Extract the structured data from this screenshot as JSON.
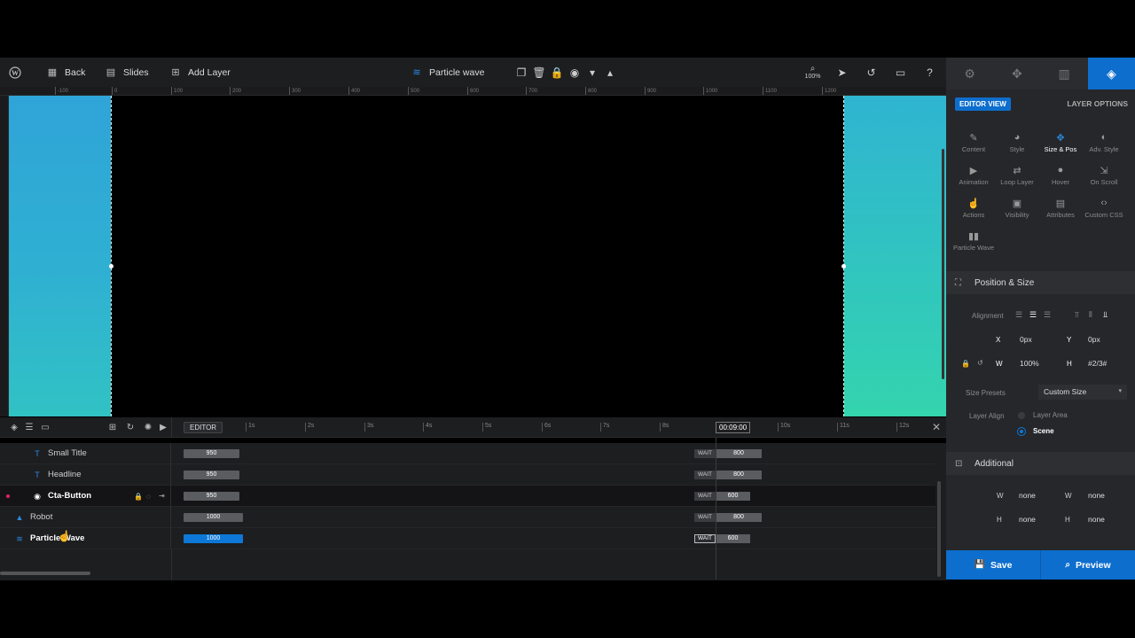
{
  "toolbar": {
    "back_label": "Back",
    "slides_label": "Slides",
    "add_layer_label": "Add Layer",
    "layer_name": "Particle wave",
    "zoom_label": "100%"
  },
  "ruler": {
    "ticks": [
      "-100",
      "0",
      "100",
      "200",
      "300",
      "400",
      "500",
      "600",
      "700",
      "800",
      "900",
      "1000",
      "1100",
      "1200"
    ]
  },
  "timeline": {
    "editor_label": "EDITOR",
    "current_time": "00:09:00",
    "time_labels": [
      "1s",
      "2s",
      "3s",
      "4s",
      "5s",
      "6s",
      "7s",
      "8s",
      "10s",
      "11s",
      "12s"
    ]
  },
  "layers": [
    {
      "name": "Small Title",
      "icon": "text-icon",
      "start": "950",
      "wait": "WAIT",
      "end": "800"
    },
    {
      "name": "Headline",
      "icon": "text-icon",
      "start": "950",
      "wait": "WAIT",
      "end": "800"
    },
    {
      "name": "Cta-Button",
      "icon": "button-icon",
      "start": "950",
      "wait": "WAIT",
      "end": "600"
    },
    {
      "name": "Robot",
      "icon": "image-icon",
      "start": "1000",
      "wait": "WAIT",
      "end": "800"
    },
    {
      "name": "Particle Wave",
      "icon": "particle-icon",
      "start": "1000",
      "wait": "WAIT",
      "end": "600"
    }
  ],
  "panel": {
    "editor_view_label": "EDITOR VIEW",
    "layer_options_label": "LAYER OPTIONS",
    "options": [
      {
        "label": "Content",
        "icon": "pencil-icon"
      },
      {
        "label": "Style",
        "icon": "palette-icon"
      },
      {
        "label": "Size & Pos",
        "icon": "move-icon"
      },
      {
        "label": "Adv. Style",
        "icon": "contrast-icon"
      },
      {
        "label": "Animation",
        "icon": "play-icon"
      },
      {
        "label": "Loop Layer",
        "icon": "loop-icon"
      },
      {
        "label": "Hover",
        "icon": "pointer-icon"
      },
      {
        "label": "On Scroll",
        "icon": "scroll-icon"
      },
      {
        "label": "Actions",
        "icon": "hand-icon"
      },
      {
        "label": "Visibility",
        "icon": "visibility-icon"
      },
      {
        "label": "Attributes",
        "icon": "document-icon"
      },
      {
        "label": "Custom CSS",
        "icon": "code-icon"
      },
      {
        "label": "Particle Wave",
        "icon": "bars-icon"
      }
    ],
    "position_size": {
      "title": "Position & Size",
      "alignment_label": "Alignment",
      "x_label": "X",
      "x_value": "0px",
      "y_label": "Y",
      "y_value": "0px",
      "w_label": "W",
      "w_value": "100%",
      "h_label": "H",
      "h_value": "#2/3#",
      "size_presets_label": "Size Presets",
      "size_presets_value": "Custom Size",
      "layer_align_label": "Layer Align",
      "layer_align_options": [
        "Layer Area",
        "Scene"
      ]
    },
    "additional": {
      "title": "Additional",
      "values": [
        "none",
        "none",
        "none",
        "none"
      ]
    },
    "save_label": "Save",
    "preview_label": "Preview"
  },
  "colors": {
    "accent": "#0d6ecd",
    "gradient_top": "#2fa4d8",
    "gradient_bottom": "#34d4ae"
  }
}
